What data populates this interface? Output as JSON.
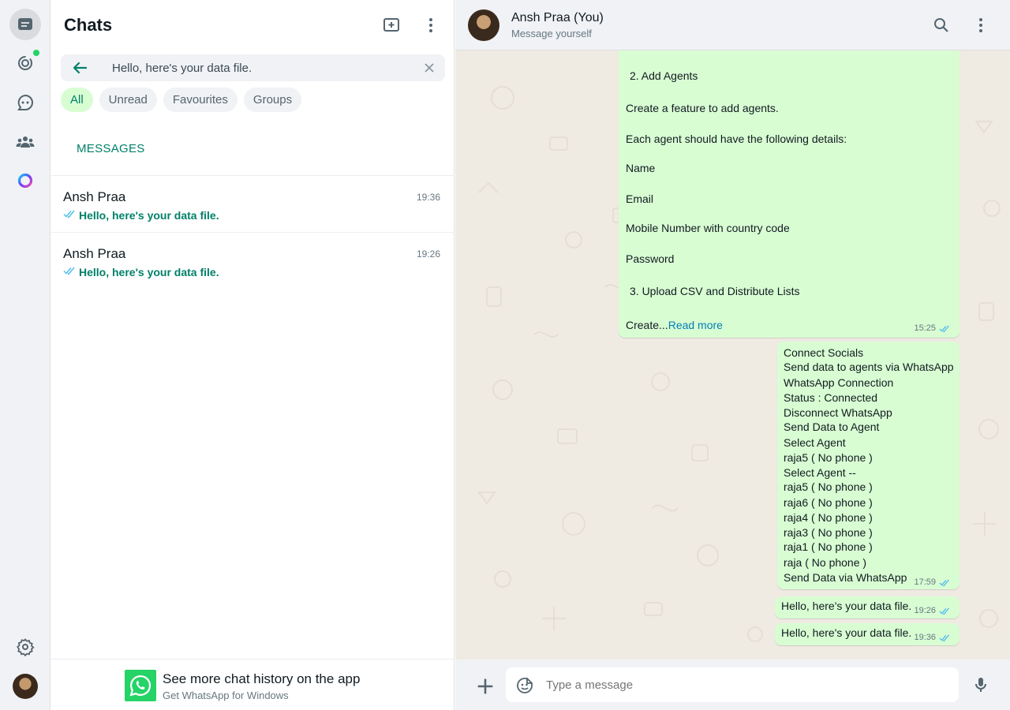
{
  "rail": {
    "icons": [
      "chats-icon",
      "status-icon",
      "channels-icon",
      "communities-icon",
      "meta-ai-icon",
      "settings-icon",
      "profile-avatar"
    ]
  },
  "sidebar": {
    "title": "Chats",
    "search": {
      "value": "Hello, here's your data file."
    },
    "filters": [
      "All",
      "Unread",
      "Favourites",
      "Groups"
    ],
    "active_filter": "All",
    "section_label": "MESSAGES",
    "results": [
      {
        "name": "Ansh Praa",
        "time": "19:36",
        "snippet": "Hello, here's your data file."
      },
      {
        "name": "Ansh Praa",
        "time": "19:26",
        "snippet": "Hello, here's your data file."
      }
    ],
    "promo": {
      "title": "See more chat history on the app",
      "subtitle": "Get WhatsApp for Windows"
    }
  },
  "conversation": {
    "name": "Ansh Praa (You)",
    "subtitle": "Message yourself",
    "messages": [
      {
        "lines": [
          "2.  Add Agents",
          "Create a feature to add agents.",
          "Each agent should have the following details:",
          "Name",
          "Email",
          "Mobile Number with country code",
          "Password",
          "3.  Upload CSV and Distribute Lists",
          "Create..."
        ],
        "read_more": "Read more",
        "time": "15:25"
      },
      {
        "lines": [
          "Connect Socials",
          "Send data to agents via WhatsApp",
          "WhatsApp Connection",
          "Status : Connected",
          "Disconnect WhatsApp",
          "Send Data to Agent",
          "Select Agent",
          "raja5 ( No phone )",
          "Select Agent --",
          "raja5 ( No phone )",
          "raja6 ( No phone )",
          "raja4 ( No phone )",
          "raja3 ( No phone )",
          "raja1 ( No phone )",
          "raja ( No phone )",
          "Send Data via WhatsApp"
        ],
        "time": "17:59"
      },
      {
        "text": "Hello, here's your data file.",
        "time": "19:26"
      },
      {
        "text": "Hello, here's your data file.",
        "time": "19:36"
      }
    ],
    "composer": {
      "placeholder": "Type a message"
    }
  },
  "colors": {
    "accent": "#008069",
    "bubble_out": "#d9fdd3",
    "tick_read": "#53bdeb",
    "online_dot": "#25d366"
  }
}
